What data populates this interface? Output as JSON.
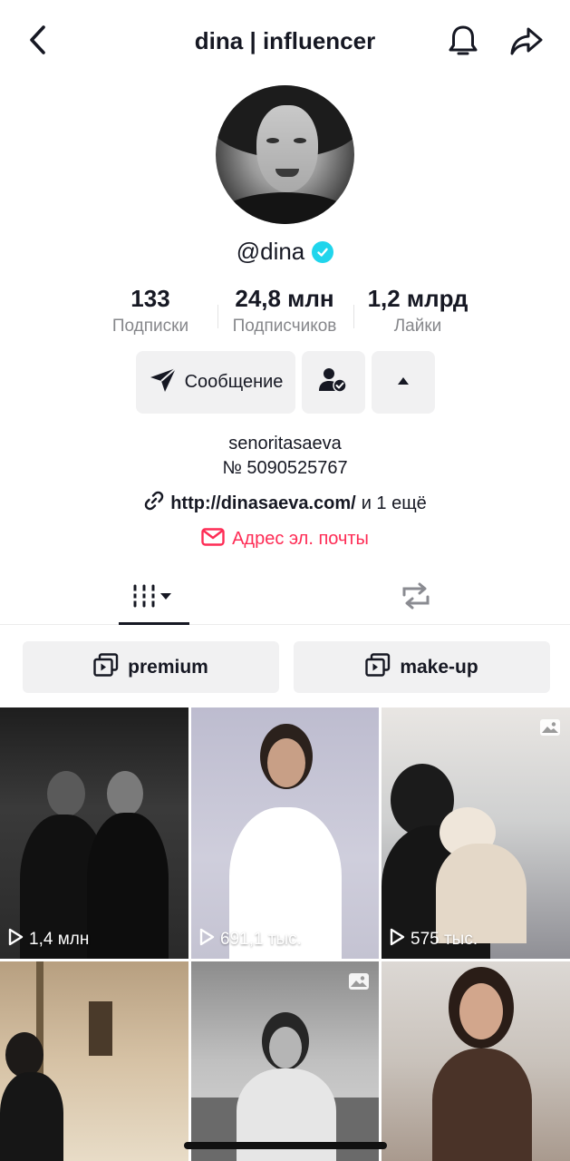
{
  "header": {
    "title": "dina | influencer",
    "back_icon": "chevron-left-icon",
    "bell_icon": "bell-icon",
    "share_icon": "share-arrow-icon"
  },
  "profile": {
    "handle": "@dina",
    "verified_color": "#20d5ec"
  },
  "stats": [
    {
      "value": "133",
      "label": "Подписки"
    },
    {
      "value": "24,8 млн",
      "label": "Подписчиков"
    },
    {
      "value": "1,2 млрд",
      "label": "Лайки"
    }
  ],
  "actions": {
    "message_label": "Сообщение",
    "message_icon": "send-icon",
    "follow_icon": "user-check-icon",
    "more_icon": "triangle-up-icon"
  },
  "bio": {
    "line1": "senoritasaeva",
    "line2": "№ 5090525767",
    "link": "http://dinasaeva.com/",
    "link_more": "и 1 ещё",
    "email_label": "Адрес эл. почты",
    "accent_color": "#fe2c55"
  },
  "tabs": [
    {
      "name": "videos",
      "icon": "grid-icon"
    },
    {
      "name": "reposts",
      "icon": "repost-icon"
    }
  ],
  "playlists": [
    {
      "label": "premium"
    },
    {
      "label": "make-up"
    }
  ],
  "videos": [
    {
      "views": "1,4 млн"
    },
    {
      "views": "691,1 тыс."
    },
    {
      "views": "575 тыс."
    }
  ]
}
